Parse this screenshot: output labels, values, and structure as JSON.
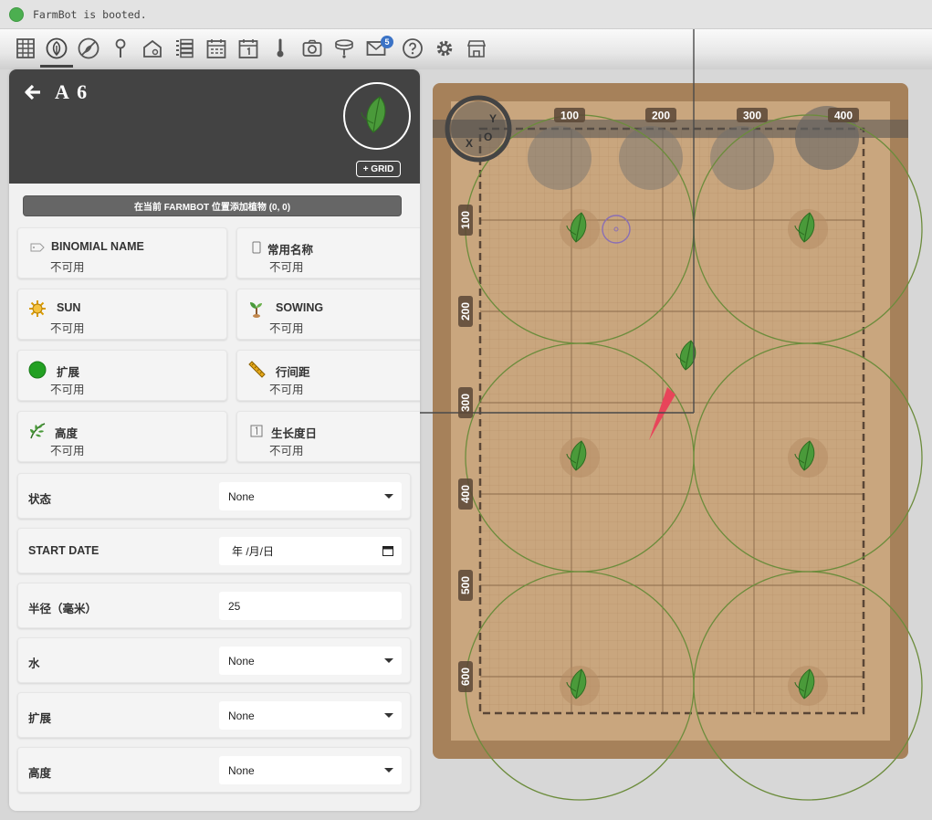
{
  "status": {
    "text": "FarmBot is booted.",
    "color": "#4caf50"
  },
  "toolbar": {
    "items": [
      "grid-icon",
      "plant-icon",
      "weeds-icon",
      "point-icon",
      "farmware-icon",
      "sequences-icon",
      "regimens-icon",
      "calendar-icon",
      "sensors-icon",
      "photos-icon",
      "tools-icon",
      "messages-icon",
      "help-icon",
      "settings-icon",
      "shop-icon"
    ],
    "mail_badge": "5"
  },
  "panel": {
    "title": "A 6",
    "grid_button": "+ GRID",
    "add_plant_button": "在当前 FARMBOT 位置添加植物 (0, 0)",
    "info_cards": [
      {
        "label": "BINOMIAL NAME",
        "value": "不可用",
        "icon": "tag-icon"
      },
      {
        "label": "常用名称",
        "value": "不可用",
        "icon": "phone-icon"
      },
      {
        "label": "SUN",
        "value": "不可用",
        "icon": "sun-icon"
      },
      {
        "label": "SOWING",
        "value": "不可用",
        "icon": "sprout-icon"
      },
      {
        "label": "扩展",
        "value": "不可用",
        "icon": "spread-icon"
      },
      {
        "label": "行间距",
        "value": "不可用",
        "icon": "ruler-icon"
      },
      {
        "label": "高度",
        "value": "不可用",
        "icon": "height-icon"
      },
      {
        "label": "生长度日",
        "value": "不可用",
        "icon": "calendar-day-icon"
      }
    ],
    "fields": {
      "status": {
        "label": "状态",
        "value": "None"
      },
      "start_date": {
        "label": "START DATE",
        "value": "年 /月/日"
      },
      "radius": {
        "label": "半径（毫米）",
        "value": "25"
      },
      "water": {
        "label": "水",
        "value": "None"
      },
      "spread": {
        "label": "扩展",
        "value": "None"
      },
      "height": {
        "label": "高度",
        "value": "None"
      }
    }
  },
  "map": {
    "x_ticks": [
      "100",
      "200",
      "300",
      "400"
    ],
    "y_ticks": [
      "100",
      "200",
      "300",
      "400",
      "500",
      "600"
    ],
    "origin_labels": {
      "x": "X",
      "y": "Y",
      "o": "O"
    },
    "colors": {
      "soil": "#c9a67e",
      "frame": "#a6815a",
      "circle": "#7a9a4a",
      "leaf": "#4a9a3a"
    }
  }
}
